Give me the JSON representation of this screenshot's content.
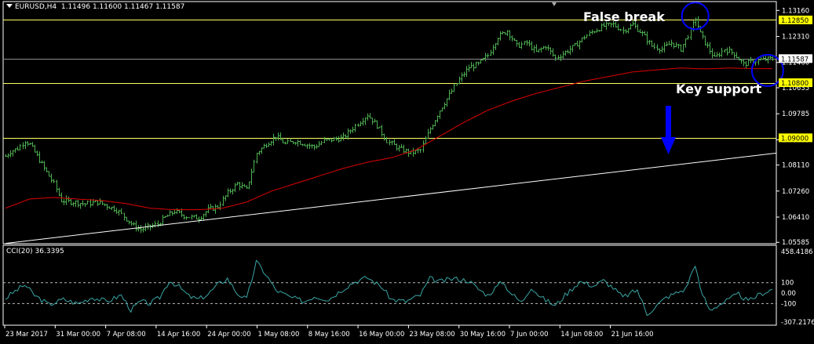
{
  "header": {
    "symbol_tf": "EURUSD,H4",
    "ohlc": "1.11496 1.11600 1.11467 1.11587"
  },
  "indicator_header": "CCI(20) 36.3395",
  "annotations": {
    "false_break": "False break",
    "key_support": "Key support"
  },
  "colors": {
    "background": "#000000",
    "candles": "#4caf50",
    "ma": "#e00000",
    "trendline": "#ffffff",
    "support_lines": "#ffff66",
    "price_line": "#8c8c8c",
    "highlight_label": "#ffff00",
    "circles": "#0000ff",
    "arrow": "#0000ff",
    "cci_line": "#3aa6a6",
    "axis": "#ffffff"
  },
  "icons": {
    "collapse": "triangle-down-icon",
    "arrow": "down-arrow-icon",
    "circles": "circle-marker"
  },
  "chart_data": [
    {
      "type": "line",
      "subtype": "ohlc-bars",
      "title": "EURUSD,H4",
      "x_tick_labels": [
        "23 Mar 2017",
        "31 Mar 00:00",
        "7 Apr 08:00",
        "14 Apr 16:00",
        "24 Apr 00:00",
        "1 May 08:00",
        "8 May 16:00",
        "16 May 00:00",
        "23 May 08:00",
        "30 May 16:00",
        "7 Jun 00:00",
        "14 Jun 08:00",
        "21 Jun 16:00"
      ],
      "y_tick_labels": [
        "1.13160",
        "1.12310",
        "1.11460",
        "1.10635",
        "1.09785",
        "1.08935",
        "1.08110",
        "1.07260",
        "1.06410",
        "1.05585"
      ],
      "ylim": [
        1.0554,
        1.1345
      ],
      "price_anchors": [
        [
          0,
          1.084
        ],
        [
          2,
          1.0855
        ],
        [
          5,
          1.0865
        ],
        [
          8,
          1.089
        ],
        [
          10,
          1.0878
        ],
        [
          13,
          1.084
        ],
        [
          16,
          1.08
        ],
        [
          20,
          1.075
        ],
        [
          23,
          1.0695
        ],
        [
          28,
          1.069
        ],
        [
          33,
          1.0684
        ],
        [
          38,
          1.069
        ],
        [
          42,
          1.0678
        ],
        [
          46,
          1.0665
        ],
        [
          50,
          1.0635
        ],
        [
          53,
          1.0612
        ],
        [
          56,
          1.06
        ],
        [
          60,
          1.061
        ],
        [
          63,
          1.0618
        ],
        [
          66,
          1.064
        ],
        [
          70,
          1.066
        ],
        [
          74,
          1.0645
        ],
        [
          77,
          1.064
        ],
        [
          80,
          1.0638
        ],
        [
          84,
          1.0665
        ],
        [
          88,
          1.0675
        ],
        [
          92,
          1.072
        ],
        [
          96,
          1.075
        ],
        [
          100,
          1.073
        ],
        [
          104,
          1.085
        ],
        [
          108,
          1.088
        ],
        [
          112,
          1.0905
        ],
        [
          116,
          1.088
        ],
        [
          120,
          1.089
        ],
        [
          124,
          1.088
        ],
        [
          128,
          1.087
        ],
        [
          132,
          1.089
        ],
        [
          136,
          1.0895
        ],
        [
          140,
          1.09
        ],
        [
          145,
          1.094
        ],
        [
          150,
          1.0975
        ],
        [
          154,
          1.094
        ],
        [
          158,
          1.089
        ],
        [
          163,
          1.0865
        ],
        [
          168,
          1.085
        ],
        [
          172,
          1.086
        ],
        [
          176,
          1.093
        ],
        [
          180,
          1.099
        ],
        [
          184,
          1.104
        ],
        [
          188,
          1.109
        ],
        [
          192,
          1.113
        ],
        [
          196,
          1.114
        ],
        [
          200,
          1.117
        ],
        [
          204,
          1.123
        ],
        [
          208,
          1.125
        ],
        [
          212,
          1.12
        ],
        [
          216,
          1.121
        ],
        [
          220,
          1.118
        ],
        [
          224,
          1.12
        ],
        [
          228,
          1.116
        ],
        [
          232,
          1.118
        ],
        [
          236,
          1.12
        ],
        [
          240,
          1.123
        ],
        [
          244,
          1.125
        ],
        [
          248,
          1.1265
        ],
        [
          252,
          1.127
        ],
        [
          256,
          1.125
        ],
        [
          260,
          1.127
        ],
        [
          264,
          1.124
        ],
        [
          268,
          1.12
        ],
        [
          272,
          1.119
        ],
        [
          276,
          1.121
        ],
        [
          280,
          1.119
        ],
        [
          284,
          1.125
        ],
        [
          286,
          1.129
        ],
        [
          288,
          1.124
        ],
        [
          290,
          1.121
        ],
        [
          294,
          1.116
        ],
        [
          298,
          1.119
        ],
        [
          302,
          1.1175
        ],
        [
          306,
          1.114
        ],
        [
          310,
          1.115
        ],
        [
          314,
          1.1155
        ],
        [
          318,
          1.1159
        ]
      ],
      "ma_anchors": [
        [
          0,
          1.067
        ],
        [
          10,
          1.07
        ],
        [
          20,
          1.0705
        ],
        [
          30,
          1.07
        ],
        [
          40,
          1.0695
        ],
        [
          50,
          1.0685
        ],
        [
          60,
          1.067
        ],
        [
          70,
          1.0665
        ],
        [
          80,
          1.0665
        ],
        [
          90,
          1.067
        ],
        [
          100,
          1.069
        ],
        [
          110,
          1.0725
        ],
        [
          120,
          1.075
        ],
        [
          130,
          1.0775
        ],
        [
          140,
          1.08
        ],
        [
          150,
          1.082
        ],
        [
          160,
          1.0835
        ],
        [
          170,
          1.086
        ],
        [
          180,
          1.0905
        ],
        [
          190,
          1.095
        ],
        [
          200,
          1.099
        ],
        [
          210,
          1.102
        ],
        [
          220,
          1.1045
        ],
        [
          230,
          1.1065
        ],
        [
          240,
          1.1085
        ],
        [
          250,
          1.11
        ],
        [
          260,
          1.1115
        ],
        [
          270,
          1.1122
        ],
        [
          280,
          1.1128
        ],
        [
          290,
          1.1125
        ],
        [
          300,
          1.1128
        ],
        [
          310,
          1.1126
        ],
        [
          318,
          1.1126
        ]
      ],
      "trendline": [
        [
          0,
          1.0555
        ],
        [
          383,
          1.085
        ]
      ],
      "horizontal_levels": [
        {
          "label": "1.12850",
          "value": 1.1285,
          "highlight": true
        },
        {
          "label": "1.11587",
          "value": 1.11587,
          "highlight": false,
          "current": true
        },
        {
          "label": "1.10800",
          "value": 1.108,
          "highlight": true
        },
        {
          "label": "1.09000",
          "value": 1.09,
          "highlight": true
        }
      ],
      "bars_count": 319
    },
    {
      "type": "line",
      "title": "CCI(20) 36.3395",
      "y_tick_labels": [
        "458.4186",
        "100",
        "0.00",
        "-100",
        "-307.2176"
      ],
      "ylim": [
        -307.2176,
        458.4186
      ],
      "reference_levels": [
        100,
        -100
      ],
      "cci_anchors": [
        [
          0,
          -50
        ],
        [
          4,
          20
        ],
        [
          8,
          80
        ],
        [
          12,
          -20
        ],
        [
          18,
          -110
        ],
        [
          24,
          -60
        ],
        [
          30,
          -100
        ],
        [
          36,
          -40
        ],
        [
          42,
          -80
        ],
        [
          48,
          -20
        ],
        [
          52,
          -160
        ],
        [
          56,
          -80
        ],
        [
          60,
          -100
        ],
        [
          64,
          -40
        ],
        [
          68,
          120
        ],
        [
          72,
          60
        ],
        [
          76,
          -30
        ],
        [
          80,
          -60
        ],
        [
          84,
          -10
        ],
        [
          88,
          80
        ],
        [
          92,
          140
        ],
        [
          96,
          0
        ],
        [
          100,
          -60
        ],
        [
          104,
          300
        ],
        [
          108,
          180
        ],
        [
          112,
          30
        ],
        [
          118,
          -40
        ],
        [
          124,
          -80
        ],
        [
          128,
          -30
        ],
        [
          134,
          -60
        ],
        [
          140,
          40
        ],
        [
          144,
          100
        ],
        [
          150,
          150
        ],
        [
          156,
          60
        ],
        [
          160,
          -60
        ],
        [
          166,
          -80
        ],
        [
          172,
          -20
        ],
        [
          176,
          140
        ],
        [
          180,
          110
        ],
        [
          186,
          140
        ],
        [
          192,
          120
        ],
        [
          196,
          40
        ],
        [
          200,
          -20
        ],
        [
          206,
          110
        ],
        [
          210,
          -10
        ],
        [
          214,
          -90
        ],
        [
          218,
          60
        ],
        [
          222,
          -40
        ],
        [
          228,
          -120
        ],
        [
          232,
          -20
        ],
        [
          238,
          110
        ],
        [
          244,
          70
        ],
        [
          248,
          120
        ],
        [
          252,
          50
        ],
        [
          256,
          -40
        ],
        [
          262,
          30
        ],
        [
          266,
          -200
        ],
        [
          270,
          -120
        ],
        [
          274,
          -40
        ],
        [
          278,
          0
        ],
        [
          282,
          40
        ],
        [
          286,
          280
        ],
        [
          288,
          40
        ],
        [
          292,
          -160
        ],
        [
          296,
          -110
        ],
        [
          300,
          -60
        ],
        [
          304,
          -10
        ],
        [
          308,
          -80
        ],
        [
          312,
          -20
        ],
        [
          316,
          20
        ],
        [
          318,
          36
        ]
      ]
    }
  ]
}
